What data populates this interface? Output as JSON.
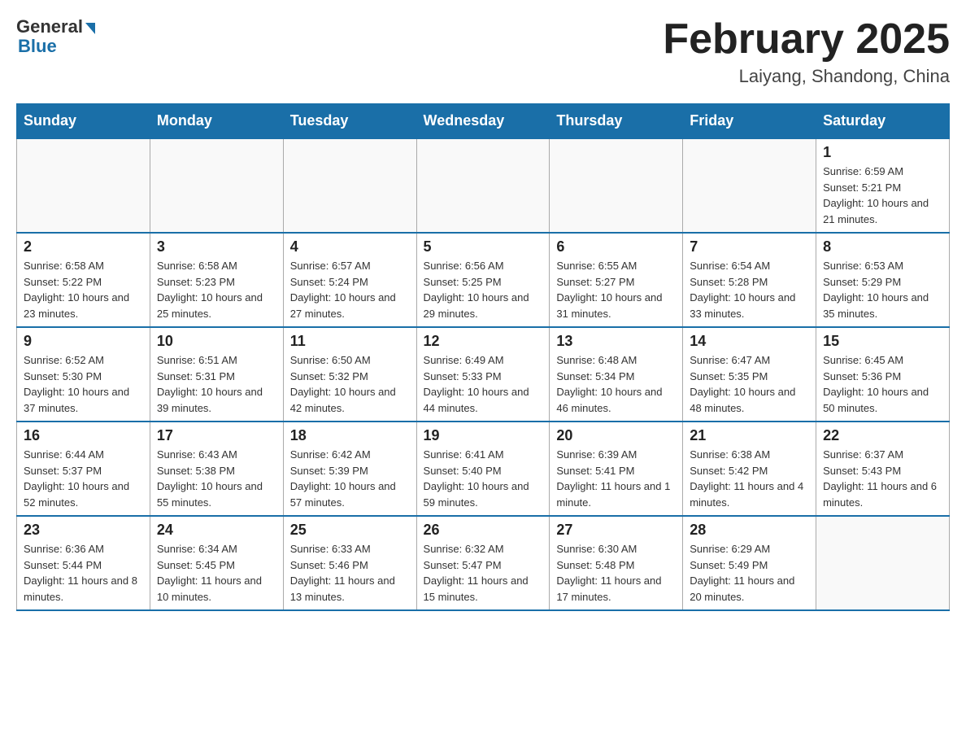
{
  "header": {
    "logo_general": "General",
    "logo_blue": "Blue",
    "month_title": "February 2025",
    "location": "Laiyang, Shandong, China"
  },
  "days_of_week": [
    "Sunday",
    "Monday",
    "Tuesday",
    "Wednesday",
    "Thursday",
    "Friday",
    "Saturday"
  ],
  "weeks": [
    [
      {
        "day": "",
        "info": ""
      },
      {
        "day": "",
        "info": ""
      },
      {
        "day": "",
        "info": ""
      },
      {
        "day": "",
        "info": ""
      },
      {
        "day": "",
        "info": ""
      },
      {
        "day": "",
        "info": ""
      },
      {
        "day": "1",
        "info": "Sunrise: 6:59 AM\nSunset: 5:21 PM\nDaylight: 10 hours and 21 minutes."
      }
    ],
    [
      {
        "day": "2",
        "info": "Sunrise: 6:58 AM\nSunset: 5:22 PM\nDaylight: 10 hours and 23 minutes."
      },
      {
        "day": "3",
        "info": "Sunrise: 6:58 AM\nSunset: 5:23 PM\nDaylight: 10 hours and 25 minutes."
      },
      {
        "day": "4",
        "info": "Sunrise: 6:57 AM\nSunset: 5:24 PM\nDaylight: 10 hours and 27 minutes."
      },
      {
        "day": "5",
        "info": "Sunrise: 6:56 AM\nSunset: 5:25 PM\nDaylight: 10 hours and 29 minutes."
      },
      {
        "day": "6",
        "info": "Sunrise: 6:55 AM\nSunset: 5:27 PM\nDaylight: 10 hours and 31 minutes."
      },
      {
        "day": "7",
        "info": "Sunrise: 6:54 AM\nSunset: 5:28 PM\nDaylight: 10 hours and 33 minutes."
      },
      {
        "day": "8",
        "info": "Sunrise: 6:53 AM\nSunset: 5:29 PM\nDaylight: 10 hours and 35 minutes."
      }
    ],
    [
      {
        "day": "9",
        "info": "Sunrise: 6:52 AM\nSunset: 5:30 PM\nDaylight: 10 hours and 37 minutes."
      },
      {
        "day": "10",
        "info": "Sunrise: 6:51 AM\nSunset: 5:31 PM\nDaylight: 10 hours and 39 minutes."
      },
      {
        "day": "11",
        "info": "Sunrise: 6:50 AM\nSunset: 5:32 PM\nDaylight: 10 hours and 42 minutes."
      },
      {
        "day": "12",
        "info": "Sunrise: 6:49 AM\nSunset: 5:33 PM\nDaylight: 10 hours and 44 minutes."
      },
      {
        "day": "13",
        "info": "Sunrise: 6:48 AM\nSunset: 5:34 PM\nDaylight: 10 hours and 46 minutes."
      },
      {
        "day": "14",
        "info": "Sunrise: 6:47 AM\nSunset: 5:35 PM\nDaylight: 10 hours and 48 minutes."
      },
      {
        "day": "15",
        "info": "Sunrise: 6:45 AM\nSunset: 5:36 PM\nDaylight: 10 hours and 50 minutes."
      }
    ],
    [
      {
        "day": "16",
        "info": "Sunrise: 6:44 AM\nSunset: 5:37 PM\nDaylight: 10 hours and 52 minutes."
      },
      {
        "day": "17",
        "info": "Sunrise: 6:43 AM\nSunset: 5:38 PM\nDaylight: 10 hours and 55 minutes."
      },
      {
        "day": "18",
        "info": "Sunrise: 6:42 AM\nSunset: 5:39 PM\nDaylight: 10 hours and 57 minutes."
      },
      {
        "day": "19",
        "info": "Sunrise: 6:41 AM\nSunset: 5:40 PM\nDaylight: 10 hours and 59 minutes."
      },
      {
        "day": "20",
        "info": "Sunrise: 6:39 AM\nSunset: 5:41 PM\nDaylight: 11 hours and 1 minute."
      },
      {
        "day": "21",
        "info": "Sunrise: 6:38 AM\nSunset: 5:42 PM\nDaylight: 11 hours and 4 minutes."
      },
      {
        "day": "22",
        "info": "Sunrise: 6:37 AM\nSunset: 5:43 PM\nDaylight: 11 hours and 6 minutes."
      }
    ],
    [
      {
        "day": "23",
        "info": "Sunrise: 6:36 AM\nSunset: 5:44 PM\nDaylight: 11 hours and 8 minutes."
      },
      {
        "day": "24",
        "info": "Sunrise: 6:34 AM\nSunset: 5:45 PM\nDaylight: 11 hours and 10 minutes."
      },
      {
        "day": "25",
        "info": "Sunrise: 6:33 AM\nSunset: 5:46 PM\nDaylight: 11 hours and 13 minutes."
      },
      {
        "day": "26",
        "info": "Sunrise: 6:32 AM\nSunset: 5:47 PM\nDaylight: 11 hours and 15 minutes."
      },
      {
        "day": "27",
        "info": "Sunrise: 6:30 AM\nSunset: 5:48 PM\nDaylight: 11 hours and 17 minutes."
      },
      {
        "day": "28",
        "info": "Sunrise: 6:29 AM\nSunset: 5:49 PM\nDaylight: 11 hours and 20 minutes."
      },
      {
        "day": "",
        "info": ""
      }
    ]
  ]
}
